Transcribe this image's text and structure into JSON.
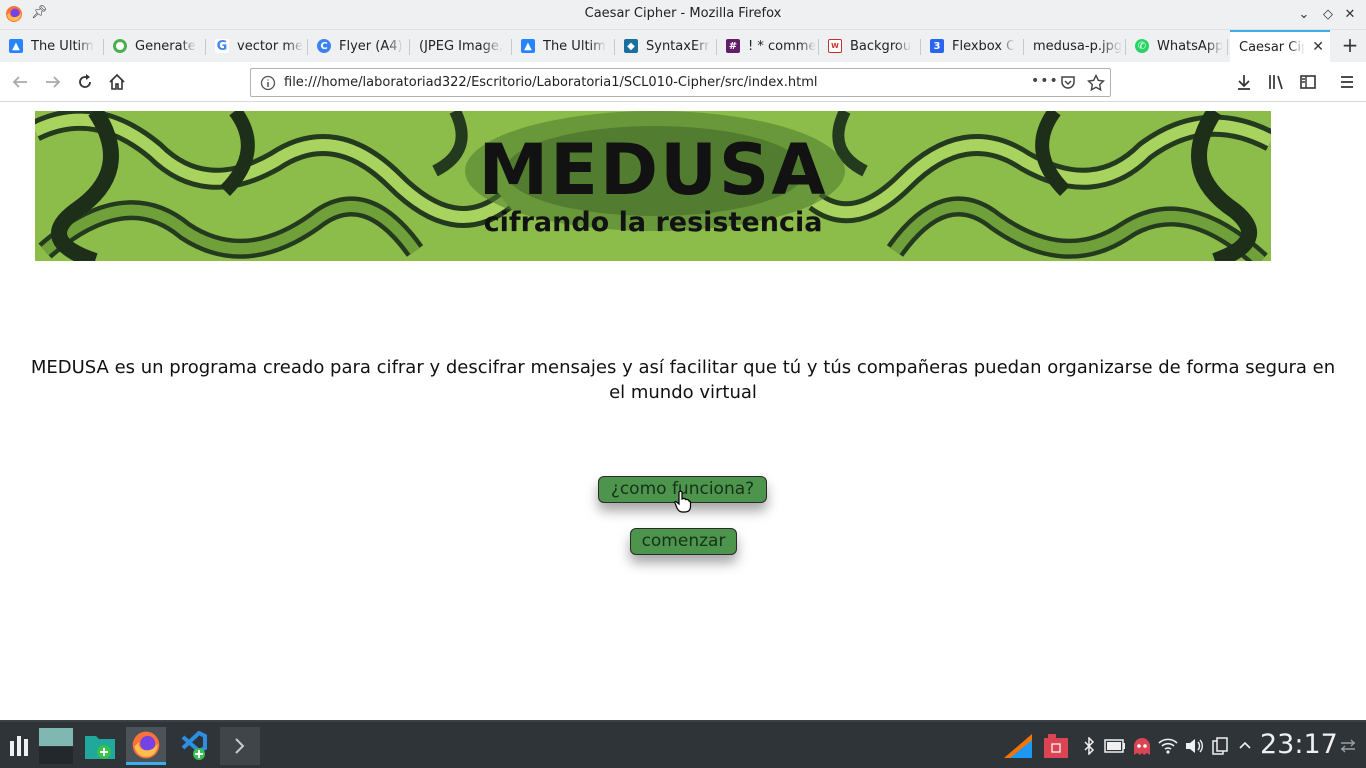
{
  "window": {
    "title": "Caesar Cipher - Mozilla Firefox"
  },
  "tabs": [
    {
      "label": "The Ultim",
      "icon": "atlassian-icon",
      "color": "#2684ff"
    },
    {
      "label": "Generate",
      "icon": "generator-icon",
      "color": "#4caf50"
    },
    {
      "label": "vector me",
      "icon": "google-icon",
      "color": "#4285f4"
    },
    {
      "label": "Flyer (A4)",
      "icon": "canva-icon",
      "color": "#3b82f6"
    },
    {
      "label": "(JPEG Image,",
      "icon": "",
      "color": ""
    },
    {
      "label": "The Ultim",
      "icon": "atlassian-icon",
      "color": "#2684ff"
    },
    {
      "label": "SyntaxErr",
      "icon": "stackoverflow-icon",
      "color": "#1a6f9e"
    },
    {
      "label": "! * comme",
      "icon": "slack-icon",
      "color": "#611f69"
    },
    {
      "label": "Backgrou",
      "icon": "w3schools-icon",
      "color": "#c4302b"
    },
    {
      "label": "Flexbox C",
      "icon": "css3-icon",
      "color": "#2965f1"
    },
    {
      "label": "medusa-p.jpg",
      "icon": "",
      "color": ""
    },
    {
      "label": "WhatsApp",
      "icon": "whatsapp-icon",
      "color": "#25d366"
    },
    {
      "label": "Caesar Cip",
      "icon": "",
      "color": "",
      "active": true
    }
  ],
  "navbar": {
    "url": "file:///home/laboratoriad322/Escritorio/Laboratoria1/SCL010-Cipher/src/index.html"
  },
  "page": {
    "banner_title": "MEDUSA",
    "banner_subtitle": "cifrando la resistencia",
    "description": "MEDUSA es un programa creado para cifrar y descifrar mensajes y así facilitar que tú y tús compañeras puedan organizarse de forma segura en el mundo virtual",
    "how_button": "¿como funciona?",
    "start_button": "comenzar",
    "button_color": "#4d944d"
  },
  "taskbar": {
    "clock": "23:17"
  }
}
